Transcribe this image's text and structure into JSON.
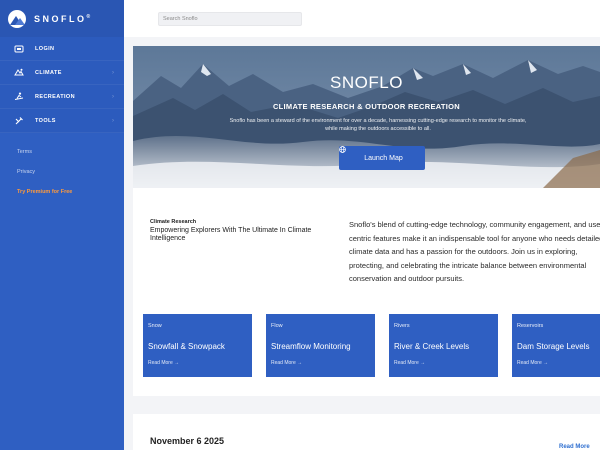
{
  "brand": {
    "name": "SNOFLO",
    "mark": "®"
  },
  "sidebar": {
    "items": [
      {
        "label": "LOGIN",
        "icon": "login-icon",
        "chevron": ""
      },
      {
        "label": "CLIMATE",
        "icon": "climate-icon",
        "chevron": "›"
      },
      {
        "label": "RECREATION",
        "icon": "recreation-icon",
        "chevron": "›"
      },
      {
        "label": "TOOLS",
        "icon": "tools-icon",
        "chevron": "›"
      }
    ],
    "links": [
      {
        "label": "Terms"
      },
      {
        "label": "Privacy"
      },
      {
        "label": "Try Premium for Free"
      }
    ],
    "collapse_label": "◂"
  },
  "search": {
    "placeholder": "Search Snoflo"
  },
  "hero": {
    "title": "SNOFLO",
    "subtitle": "CLIMATE RESEARCH & OUTDOOR RECREATION",
    "description": "Snoflo has been a steward of the environment for over a decade, harnessing cutting-edge research to monitor the climate, while making the outdoors accessible to all.",
    "button_label": "Launch Map",
    "button_icon": "globe-icon"
  },
  "info": {
    "kicker": "Climate Research",
    "headline": "Empowering Explorers With The Ultimate In Climate Intelligence",
    "body": "Snoflo's blend of cutting-edge technology, community engagement, and user-centric features make it an indispensable tool for anyone who needs detailed climate data and has a passion for the outdoors. Join us in exploring, protecting, and celebrating the intricate balance between environmental conservation and outdoor pursuits."
  },
  "cards": [
    {
      "tag": "Snow",
      "title": "Snowfall & Snowpack",
      "link": "Read More →"
    },
    {
      "tag": "Flow",
      "title": "Streamflow Monitoring",
      "link": "Read More →"
    },
    {
      "tag": "Rivers",
      "title": "River & Creek Levels",
      "link": "Read More →"
    },
    {
      "tag": "Reservoirs",
      "title": "Dam Storage Levels",
      "link": "Read More →"
    }
  ],
  "news": {
    "date": "November 6 2025",
    "more_label": "Read More"
  },
  "colors": {
    "primary": "#2f5fc2",
    "accent": "#ff9a3c",
    "link": "#2f6fd0"
  }
}
